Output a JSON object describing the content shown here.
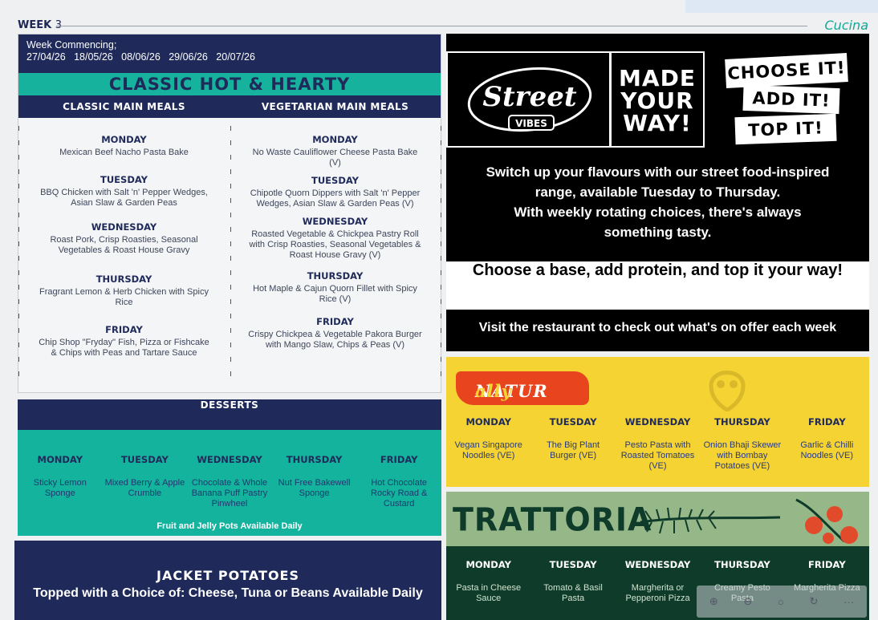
{
  "header": {
    "week_label": "WEEK",
    "week_num": "3",
    "brand": "Cucina"
  },
  "classic": {
    "week_commencing_label": "Week Commencing;",
    "week_commencing_dates": "27/04/26   18/05/26   08/06/26   29/06/26   20/07/26",
    "title": "CLASSIC HOT & HEARTY",
    "col_left_header": "CLASSIC MAIN MEALS",
    "col_right_header": "VEGETARIAN MAIN MEALS",
    "main": [
      {
        "day": "MONDAY",
        "meal": "Mexican Beef Nacho Pasta Bake"
      },
      {
        "day": "TUESDAY",
        "meal": "BBQ Chicken with Salt 'n' Pepper Wedges, Asian Slaw & Garden Peas"
      },
      {
        "day": "WEDNESDAY",
        "meal": "Roast Pork, Crisp Roasties, Seasonal Vegetables & Roast House Gravy"
      },
      {
        "day": "THURSDAY",
        "meal": "Fragrant Lemon & Herb Chicken with Spicy Rice"
      },
      {
        "day": "FRIDAY",
        "meal": "Chip Shop \"Fryday\" Fish, Pizza or Fishcake & Chips with Peas and Tartare Sauce"
      }
    ],
    "veg": [
      {
        "day": "MONDAY",
        "meal": "No Waste Cauliflower Cheese Pasta Bake (V)"
      },
      {
        "day": "TUESDAY",
        "meal": "Chipotle Quorn Dippers with Salt 'n' Pepper Wedges, Asian Slaw & Garden Peas (V)"
      },
      {
        "day": "WEDNESDAY",
        "meal": "Roasted Vegetable & Chickpea Pastry Roll with Crisp Roasties, Seasonal Vegetables & Roast House Gravy (V)"
      },
      {
        "day": "THURSDAY",
        "meal": "Hot Maple & Cajun Quorn Fillet with Spicy Rice (V)"
      },
      {
        "day": "FRIDAY",
        "meal": "Crispy Chickpea & Vegetable Pakora Burger with Mango Slaw, Chips & Peas (V)"
      }
    ]
  },
  "desserts": {
    "title": "DESSERTS",
    "days": [
      "MONDAY",
      "TUESDAY",
      "WEDNESDAY",
      "THURSDAY",
      "FRIDAY"
    ],
    "items": [
      "Sticky Lemon Sponge",
      "Mixed Berry & Apple Crumble",
      "Chocolate & Whole Banana Puff Pastry Pinwheel",
      "Nut Free Bakewell Sponge",
      "Hot Chocolate Rocky Road & Custard"
    ],
    "footer": "Fruit and Jelly Pots Available Daily"
  },
  "jacket": {
    "title": "JACKET POTATOES",
    "subtitle": "Topped with a Choice of: Cheese, Tuna or Beans Available Daily"
  },
  "street": {
    "logo_text": "Street",
    "logo_sub": "VIBES",
    "made_1": "MADE",
    "made_2": "YOUR",
    "made_3": "WAY!",
    "choose": "CHOOSE IT!",
    "add": "ADD IT!",
    "top": "TOP IT!",
    "line1": "Switch up your flavours with our street food-inspired",
    "line2a": "range, available ",
    "line2b": "Tuesday to Thursday.",
    "line3": "With weekly rotating choices, there's always",
    "line4": "something tasty.",
    "band": "Choose a base, add protein, and top it your way!",
    "visit": "Visit the restaurant to check out what's on offer each week"
  },
  "naturally": {
    "logo_a": "NATUR",
    "logo_b": "ally",
    "days": [
      "MONDAY",
      "TUESDAY",
      "WEDNESDAY",
      "THURSDAY",
      "FRIDAY"
    ],
    "items": [
      "Vegan Singapore Noodles (VE)",
      "The Big Plant Burger (VE)",
      "Pesto Pasta with Roasted Tomatoes (VE)",
      "Onion Bhaji Skewer with Bombay Potatoes (VE)",
      "Garlic & Chilli Noodles (VE)"
    ]
  },
  "trattoria": {
    "title": "TRATTORIA",
    "days": [
      "MONDAY",
      "TUESDAY",
      "WEDNESDAY",
      "THURSDAY",
      "FRIDAY"
    ],
    "items": [
      "Pasta in Cheese Sauce",
      "Tomato & Basil Pasta",
      "Margherita or Pepperoni Pizza",
      "Creamy Pesto Pasta",
      "Margherita Pizza"
    ]
  },
  "colors": {
    "navy": "#1f2a5a",
    "teal": "#17b29e",
    "yellow": "#f4d332",
    "green": "#0f3b2a",
    "sage": "#96b888",
    "orange": "#e8451f"
  },
  "viewer_toolbar": {
    "icons": [
      "zoom-in-icon",
      "zoom-out-icon",
      "search-icon",
      "rotate-icon",
      "more-icon"
    ],
    "more_label": "···"
  }
}
